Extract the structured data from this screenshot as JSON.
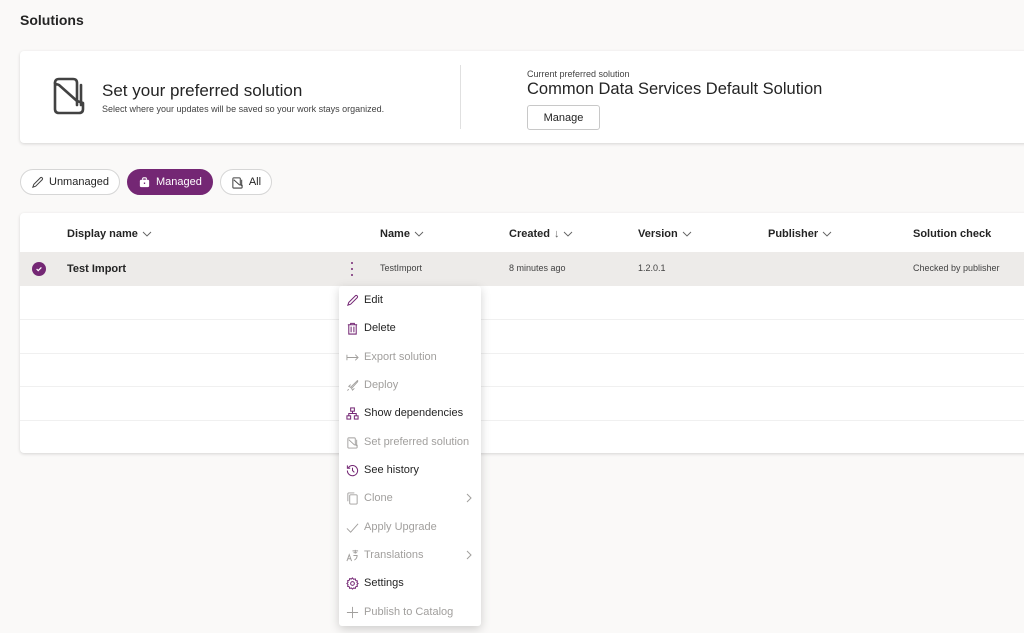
{
  "page": {
    "title": "Solutions"
  },
  "preferred": {
    "heading": "Set your preferred solution",
    "subtext": "Select where your updates will be saved so your work stays organized.",
    "current_label": "Current preferred solution",
    "current_value": "Common Data Services Default Solution",
    "manage_label": "Manage"
  },
  "filters": [
    {
      "label": "Unmanaged",
      "icon": "pencil-icon",
      "active": false
    },
    {
      "label": "Managed",
      "icon": "briefcase-icon",
      "active": true
    },
    {
      "label": "All",
      "icon": "solution-icon",
      "active": false
    }
  ],
  "grid": {
    "columns": [
      {
        "label": "Display name",
        "sort": ""
      },
      {
        "label": "Name",
        "sort": ""
      },
      {
        "label": "Created",
        "sort": "↓"
      },
      {
        "label": "Version",
        "sort": ""
      },
      {
        "label": "Publisher",
        "sort": ""
      },
      {
        "label": "Solution check",
        "sort": ""
      }
    ],
    "rows": [
      {
        "display_name": "Test Import",
        "name": "TestImport",
        "created": "8 minutes ago",
        "version": "1.2.0.1",
        "publisher": "",
        "solution_check": "Checked by publisher",
        "selected": true
      }
    ]
  },
  "context_menu": {
    "items": [
      {
        "label": "Edit",
        "icon": "pencil-icon",
        "enabled": true,
        "submenu": false
      },
      {
        "label": "Delete",
        "icon": "trash-icon",
        "enabled": true,
        "submenu": false
      },
      {
        "label": "Export solution",
        "icon": "export-arrow-icon",
        "enabled": false,
        "submenu": false
      },
      {
        "label": "Deploy",
        "icon": "rocket-icon",
        "enabled": false,
        "submenu": false
      },
      {
        "label": "Show dependencies",
        "icon": "hierarchy-icon",
        "enabled": true,
        "submenu": false
      },
      {
        "label": "Set preferred solution",
        "icon": "solution-icon",
        "enabled": false,
        "submenu": false
      },
      {
        "label": "See history",
        "icon": "history-icon",
        "enabled": true,
        "submenu": false
      },
      {
        "label": "Clone",
        "icon": "copy-icon",
        "enabled": false,
        "submenu": true
      },
      {
        "label": "Apply Upgrade",
        "icon": "checkmark-icon",
        "enabled": false,
        "submenu": false
      },
      {
        "label": "Translations",
        "icon": "translate-icon",
        "enabled": false,
        "submenu": true
      },
      {
        "label": "Settings",
        "icon": "gear-icon",
        "enabled": true,
        "submenu": false
      },
      {
        "label": "Publish to Catalog",
        "icon": "plus-icon",
        "enabled": false,
        "submenu": false
      }
    ]
  },
  "colors": {
    "accent": "#742774",
    "disabled": "#a19f9d",
    "selected_row": "#edebe9"
  }
}
